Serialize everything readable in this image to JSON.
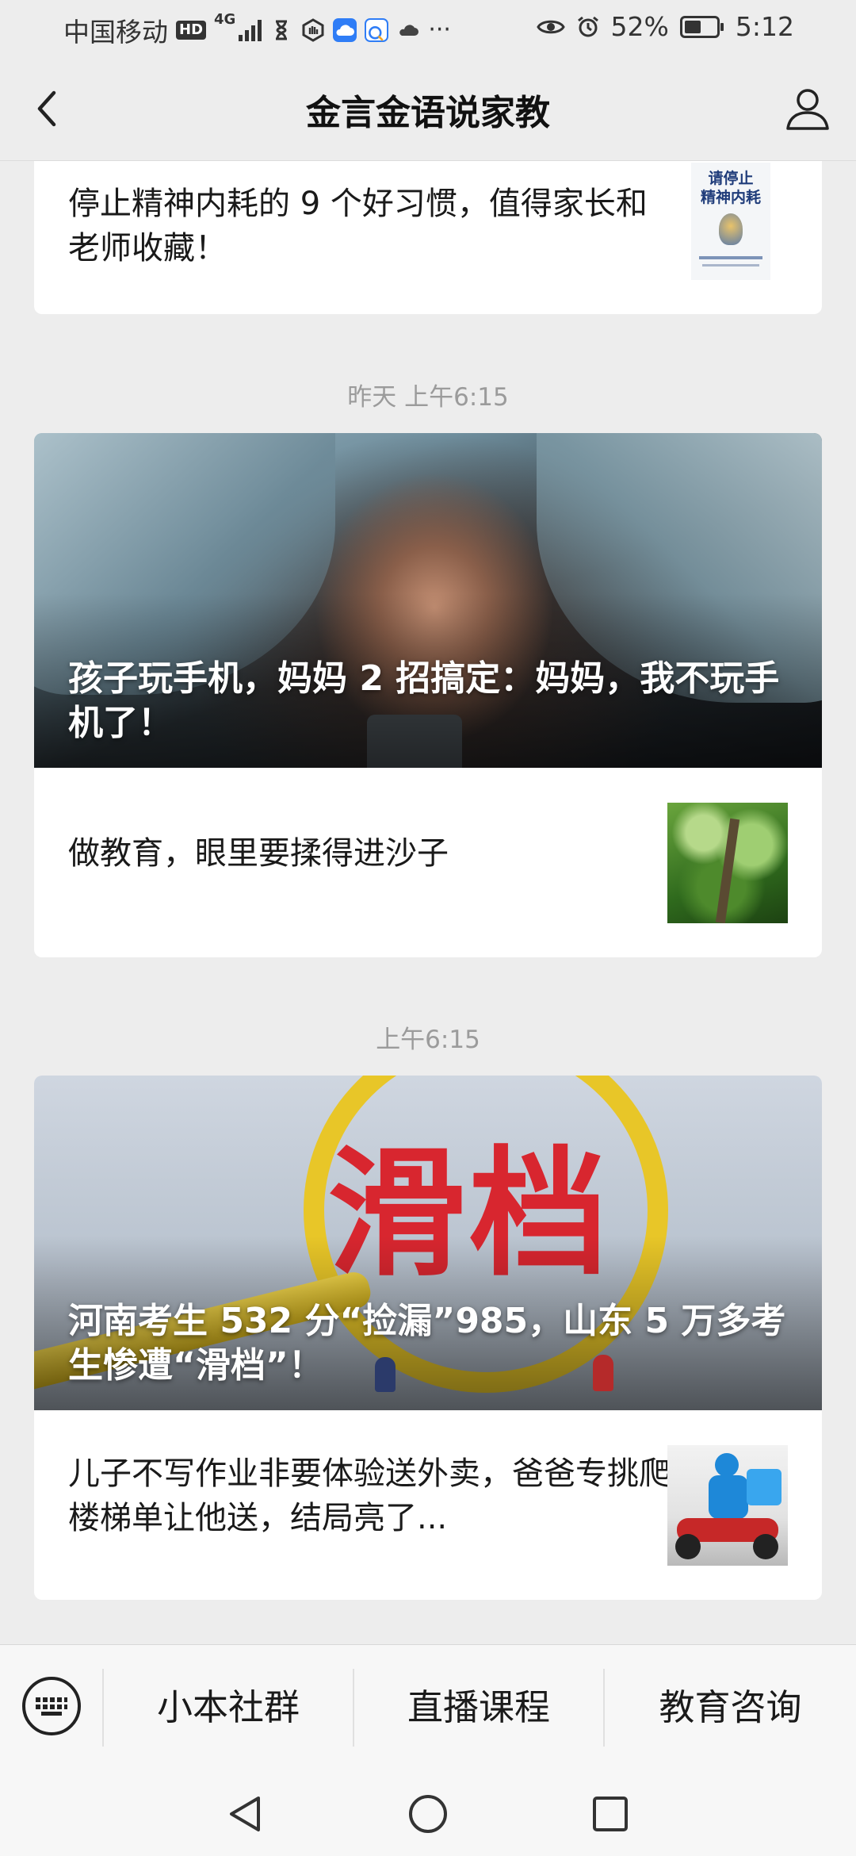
{
  "status_bar": {
    "carrier": "中国移动",
    "hd_badge": "HD",
    "network": "4G",
    "battery": "52%",
    "battery_level": 0.52,
    "time": "5:12",
    "icons": [
      "signal-icon",
      "hourglass-icon",
      "hand-icon",
      "cloud-app-icon",
      "chat-app-icon",
      "cloud-icon",
      "more-icon",
      "eye-icon",
      "alarm-icon",
      "battery-icon"
    ]
  },
  "nav": {
    "title": "金言金语说家教",
    "back_icon": "chevron-left-icon",
    "profile_icon": "user-icon"
  },
  "feed": {
    "card1": {
      "text": "停止精神内耗的 9 个好习惯，值得家长和老师收藏！",
      "thumb_text_line1": "请停止",
      "thumb_text_line2": "精神内耗"
    },
    "timestamp1": "昨天 上午6:15",
    "card2": {
      "cover_title": "孩子玩手机，妈妈 2 招搞定：妈妈，我不玩手机了！",
      "sub_text": "做教育，眼里要揉得进沙子"
    },
    "timestamp2": "上午6:15",
    "card3": {
      "cover_word": "滑档",
      "cover_title": "河南考生 532 分“捡漏”985，山东 5 万多考生惨遭“滑档”！",
      "sub_text": "儿子不写作业非要体验送外卖，爸爸专挑爬楼梯单让他送，结局亮了..."
    }
  },
  "menu": {
    "keyboard_icon": "keyboard-icon",
    "items": [
      "小本社群",
      "直播课程",
      "教育咨询"
    ]
  },
  "system_nav": [
    "back-triangle-icon",
    "home-circle-icon",
    "recents-square-icon"
  ],
  "colors": {
    "background": "#ededed",
    "card": "#ffffff",
    "timestamp": "#9b9b9b",
    "accent_red": "#d8262f",
    "accent_yellow": "#e8c628"
  }
}
